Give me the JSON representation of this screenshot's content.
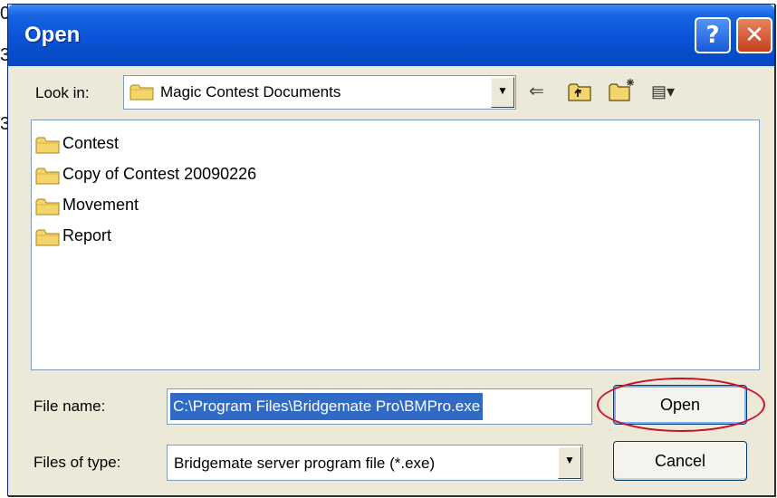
{
  "background": {
    "fragments": [
      "0",
      "3",
      "3"
    ]
  },
  "dialog": {
    "title": "Open",
    "help_glyph": "?",
    "close_glyph": "✕"
  },
  "look_in": {
    "label": "Look in:",
    "value": "Magic Contest Documents"
  },
  "toolbar": {
    "icons": [
      "back-arrow-icon",
      "up-one-level-icon",
      "new-folder-icon",
      "view-menu-icon"
    ],
    "back_glyph": "⇐",
    "views_glyph": "▤▾"
  },
  "files": [
    {
      "name": "Contest",
      "icon": "folder-icon"
    },
    {
      "name": "Copy of Contest 20090226",
      "icon": "folder-icon"
    },
    {
      "name": "Movement",
      "icon": "folder-icon"
    },
    {
      "name": "Report",
      "icon": "folder-icon"
    }
  ],
  "file_name": {
    "label": "File name:",
    "value": "C:\\Program Files\\Bridgemate Pro\\BMPro.exe"
  },
  "file_type": {
    "label": "Files of type:",
    "value": "Bridgemate server program file (*.exe)"
  },
  "buttons": {
    "open": "Open",
    "cancel": "Cancel"
  },
  "colors": {
    "title_bar": "#0a53d8",
    "selection": "#316ac5",
    "annotation": "#c8102e"
  }
}
